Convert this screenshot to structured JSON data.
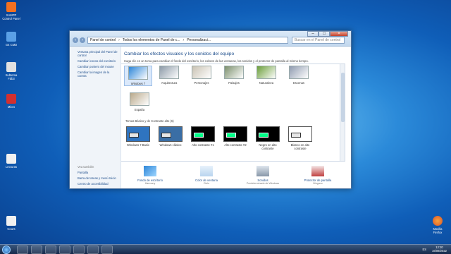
{
  "desktop": {
    "icons": [
      {
        "label": "XAMPP Control Panel",
        "color": "#f37021"
      },
      {
        "label": "G4 CMD",
        "color": "#5aa0e6"
      },
      {
        "label": "Subtema Fáb3",
        "color": "#e1e1e1"
      },
      {
        "label": "Micro",
        "color": "#d23030"
      },
      {
        "label": "Lecturas",
        "color": "#f0f0f0"
      },
      {
        "label": "Cours",
        "color": "#f0f0f0"
      }
    ],
    "firefox_label": "Mozilla Firefox"
  },
  "window": {
    "address": [
      "Panel de control",
      "Todos los elementos de Panel de c...",
      "Personalizaci..."
    ],
    "search_placeholder": "Buscar en el Panel de control",
    "sidebar": {
      "links": [
        "Ventana principal del Panel de control",
        "Cambiar iconos del escritorio",
        "Cambiar puntero del mouse",
        "Cambiar la imagen de la cuenta"
      ],
      "see_also_header": "Vea también",
      "see_also": [
        "Pantalla",
        "Barra de tareas y menú Inicio",
        "Centro de accesibilidad"
      ]
    },
    "main": {
      "title": "Cambiar los efectos visuales y los sonidos del equipo",
      "description": "Haga clic en un tema para cambiar el fondo del escritorio, los colores de las ventanas, los sonidos y el protector de pantalla al mismo tiempo.",
      "themes": [
        {
          "label": "Windows 7",
          "color": "#2e86d8",
          "selected": true
        },
        {
          "label": "Arquitectura",
          "color": "#8c9aa8",
          "selected": false
        },
        {
          "label": "Personajes",
          "color": "#c9c2b3",
          "selected": false
        },
        {
          "label": "Paisajes",
          "color": "#7b8f6d",
          "selected": false
        },
        {
          "label": "Naturaleza",
          "color": "#6b9e3a",
          "selected": false
        },
        {
          "label": "Escenas",
          "color": "#8f9bb0",
          "selected": false
        },
        {
          "label": "España",
          "color": "#b9a98b",
          "selected": false
        }
      ],
      "basic_header": "Temas Básico y de Contraste alto (6)",
      "basic_themes": [
        {
          "label": "Windows 7 Basic",
          "color": "#2f74c0",
          "dark": false
        },
        {
          "label": "Windows clásico",
          "color": "#3a6ea5",
          "dark": false
        },
        {
          "label": "Alto contraste #1",
          "color": "#000000",
          "dark": true
        },
        {
          "label": "Alto contraste #2",
          "color": "#000000",
          "dark": true
        },
        {
          "label": "Negro en alto contraste",
          "color": "#000000",
          "dark": true
        },
        {
          "label": "Blanco en alto contraste",
          "color": "#ffffff",
          "dark": false
        }
      ],
      "bottom": [
        {
          "title": "Fondo de escritorio",
          "sub": "Harmony"
        },
        {
          "title": "Color de ventana",
          "sub": "Cielo"
        },
        {
          "title": "Sonidos",
          "sub": "Predeterminado de Windows"
        },
        {
          "title": "Protector de pantalla",
          "sub": "Ninguno"
        }
      ]
    }
  },
  "taskbar": {
    "lang": "ES",
    "time": "12:20",
    "date": "16/09/2022"
  }
}
